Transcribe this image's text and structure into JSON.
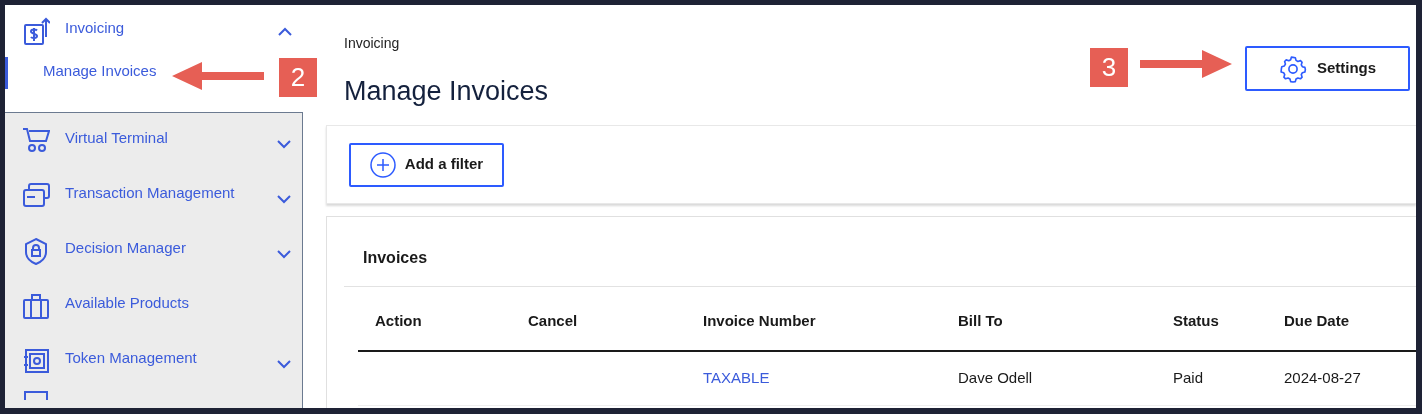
{
  "sidebar": {
    "items": [
      {
        "label": "Invoicing",
        "kind": "group",
        "expanded": true,
        "children": [
          {
            "label": "Manage Invoices",
            "selected": true
          }
        ]
      },
      {
        "label": "Virtual Terminal",
        "kind": "group",
        "expanded": false
      },
      {
        "label": "Transaction Management",
        "kind": "group",
        "expanded": false
      },
      {
        "label": "Decision Manager",
        "kind": "group",
        "expanded": false
      },
      {
        "label": "Available Products",
        "kind": "link"
      },
      {
        "label": "Token Management",
        "kind": "group",
        "expanded": false
      }
    ]
  },
  "breadcrumb": "Invoicing",
  "page_title": "Manage Invoices",
  "settings_button": "Settings",
  "filter_button": "Add a filter",
  "invoices": {
    "title": "Invoices",
    "columns": [
      "Action",
      "Cancel",
      "Invoice Number",
      "Bill To",
      "Status",
      "Due Date"
    ],
    "rows": [
      {
        "cells": [
          "",
          "",
          "TAXABLE",
          "Dave Odell",
          "Paid",
          "2024-08-27"
        ]
      }
    ]
  },
  "callouts": [
    {
      "label": "2",
      "kind": "leftward"
    },
    {
      "label": "3",
      "kind": "rightward"
    }
  ]
}
